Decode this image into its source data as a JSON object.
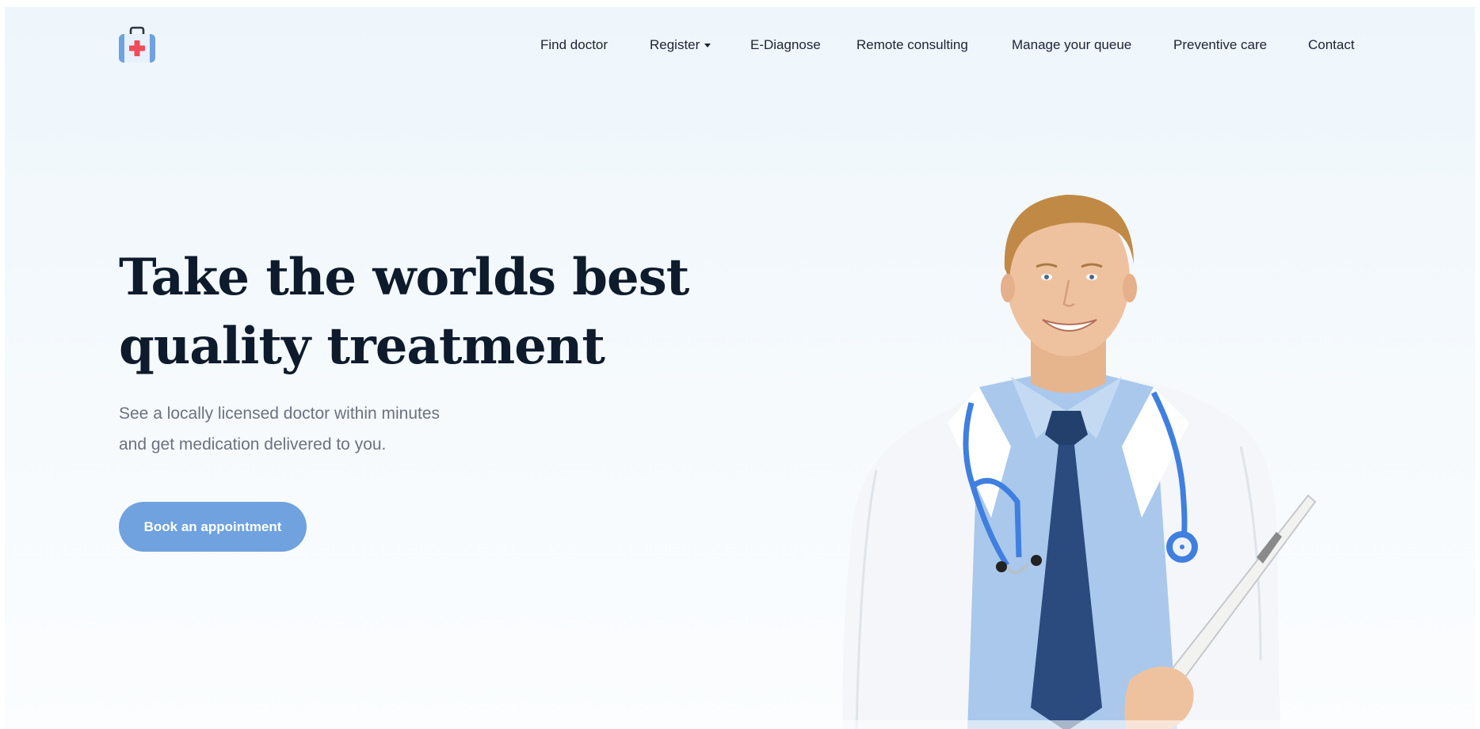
{
  "brand": {
    "logo_icon": "medical-kit-icon",
    "accent_color": "#6fa2de",
    "logo_red": "#ee4d5a"
  },
  "nav": {
    "items": [
      {
        "label": "Find doctor"
      },
      {
        "label": "Register"
      },
      {
        "label": "E-Diagnose"
      },
      {
        "label": "Remote consulting"
      },
      {
        "label": "Manage your queue"
      },
      {
        "label": "Preventive care"
      },
      {
        "label": "Contact"
      }
    ]
  },
  "hero": {
    "title_line1": "Take the worlds best",
    "title_line2": "quality treatment",
    "subtitle_line1": "See a locally licensed doctor within minutes",
    "subtitle_line2": "and get medication delivered to you.",
    "cta_label": "Book an appointment"
  }
}
